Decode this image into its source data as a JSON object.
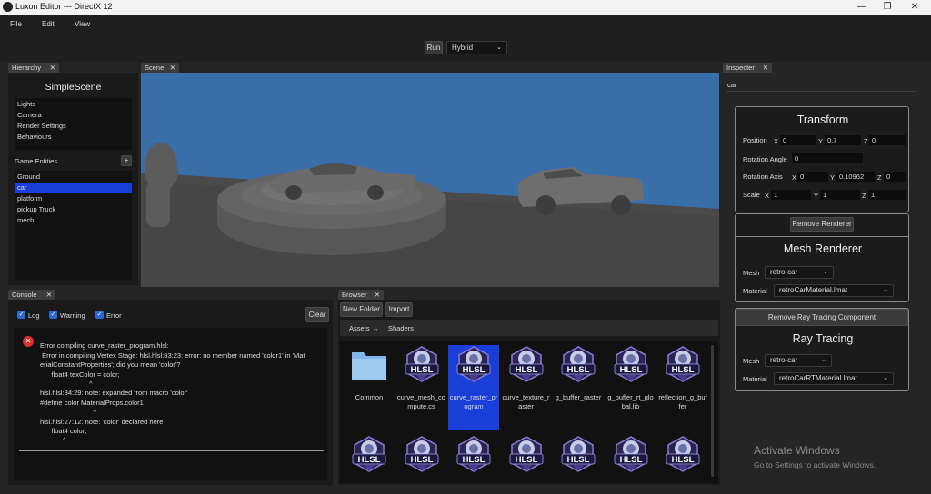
{
  "window": {
    "title": "Luxon Editor --- DirectX 12"
  },
  "menu": [
    "File",
    "Edit",
    "View"
  ],
  "toolbar": {
    "run": "Run",
    "mode": "Hybrid"
  },
  "hierarchy": {
    "tab": "Hierarchy",
    "scene": "SimpleScene",
    "items": [
      "Lights",
      "Camera",
      "Render Settings",
      "Behaviours"
    ],
    "entities_label": "Game Entities",
    "add": "+",
    "entities": [
      "Ground",
      "car",
      "platform",
      "pickup Truck",
      "mech"
    ],
    "selected": "car"
  },
  "scene": {
    "tab": "Scene"
  },
  "console": {
    "tab": "Console",
    "log": "Log",
    "warning": "Warning",
    "error": "Error",
    "clear": "Clear",
    "lines": [
      "Error compiling curve_raster_program.hlsl:",
      " Error in compiling Vertex Stage: hlsl.hlsl:83:23: error: no member named 'color1' in 'Mat",
      "erialConstantProperties'; did you mean 'color'?",
      "      float4 texColor = color;",
      "                          ^",
      "hlsl.hlsl:34:29: note: expanded from macro 'color'",
      "#define color MaterialProps.color1",
      "                            ^",
      "hlsl.hlsl:27:12: note: 'color' declared here",
      "      float4 color;",
      "            ^"
    ]
  },
  "browser": {
    "tab": "Browser",
    "new_folder": "New Folder",
    "import": "Import",
    "path": [
      "Assets",
      "→",
      "Shaders"
    ],
    "assets": [
      {
        "name": "Common",
        "type": "folder"
      },
      {
        "name": "curve_mesh_compute.cs",
        "type": "hlsl"
      },
      {
        "name": "curve_raster_program",
        "type": "hlsl",
        "selected": true
      },
      {
        "name": "curve_texture_raster",
        "type": "hlsl"
      },
      {
        "name": "g_buffer_raster",
        "type": "hlsl"
      },
      {
        "name": "g_buffer_rt_global.lib",
        "type": "hlsl"
      },
      {
        "name": "reflection_g_buffer",
        "type": "hlsl"
      }
    ],
    "row2_count": 7
  },
  "inspector": {
    "tab": "Inspecter",
    "search": "car",
    "transform": {
      "title": "Transform",
      "position_label": "Position",
      "position": {
        "x": "0",
        "y": "0.7",
        "z": "0"
      },
      "rot_angle_label": "Rotation Angle",
      "rot_angle": "0",
      "rot_axis_label": "Rotation Axis",
      "rot_axis": {
        "x": "0",
        "y": "0.10962",
        "z": "0"
      },
      "scale_label": "Scale",
      "scale": {
        "x": "1",
        "y": "1",
        "z": "1"
      }
    },
    "remove_renderer": "Remove Renderer",
    "mesh_renderer": {
      "title": "Mesh Renderer",
      "mesh_label": "Mesh",
      "mesh": "retro-car",
      "material_label": "Material",
      "material": "retroCarMaterial.lmat"
    },
    "remove_rt": "Remove Ray Tracing Component",
    "ray_tracing": {
      "title": "Ray Tracing",
      "mesh_label": "Mesh",
      "mesh": "retro-car",
      "material_label": "Material",
      "material": "retroCarRTMaterial.lmat"
    },
    "axis": {
      "x": "X",
      "y": "Y",
      "z": "Z"
    }
  },
  "watermark": {
    "title": "Activate Windows",
    "sub": "Go to Settings to activate Windows."
  },
  "colors": {
    "selection": "#1a3fd8",
    "sky": "#3a6ea8",
    "floor": "#4a4a4a"
  }
}
